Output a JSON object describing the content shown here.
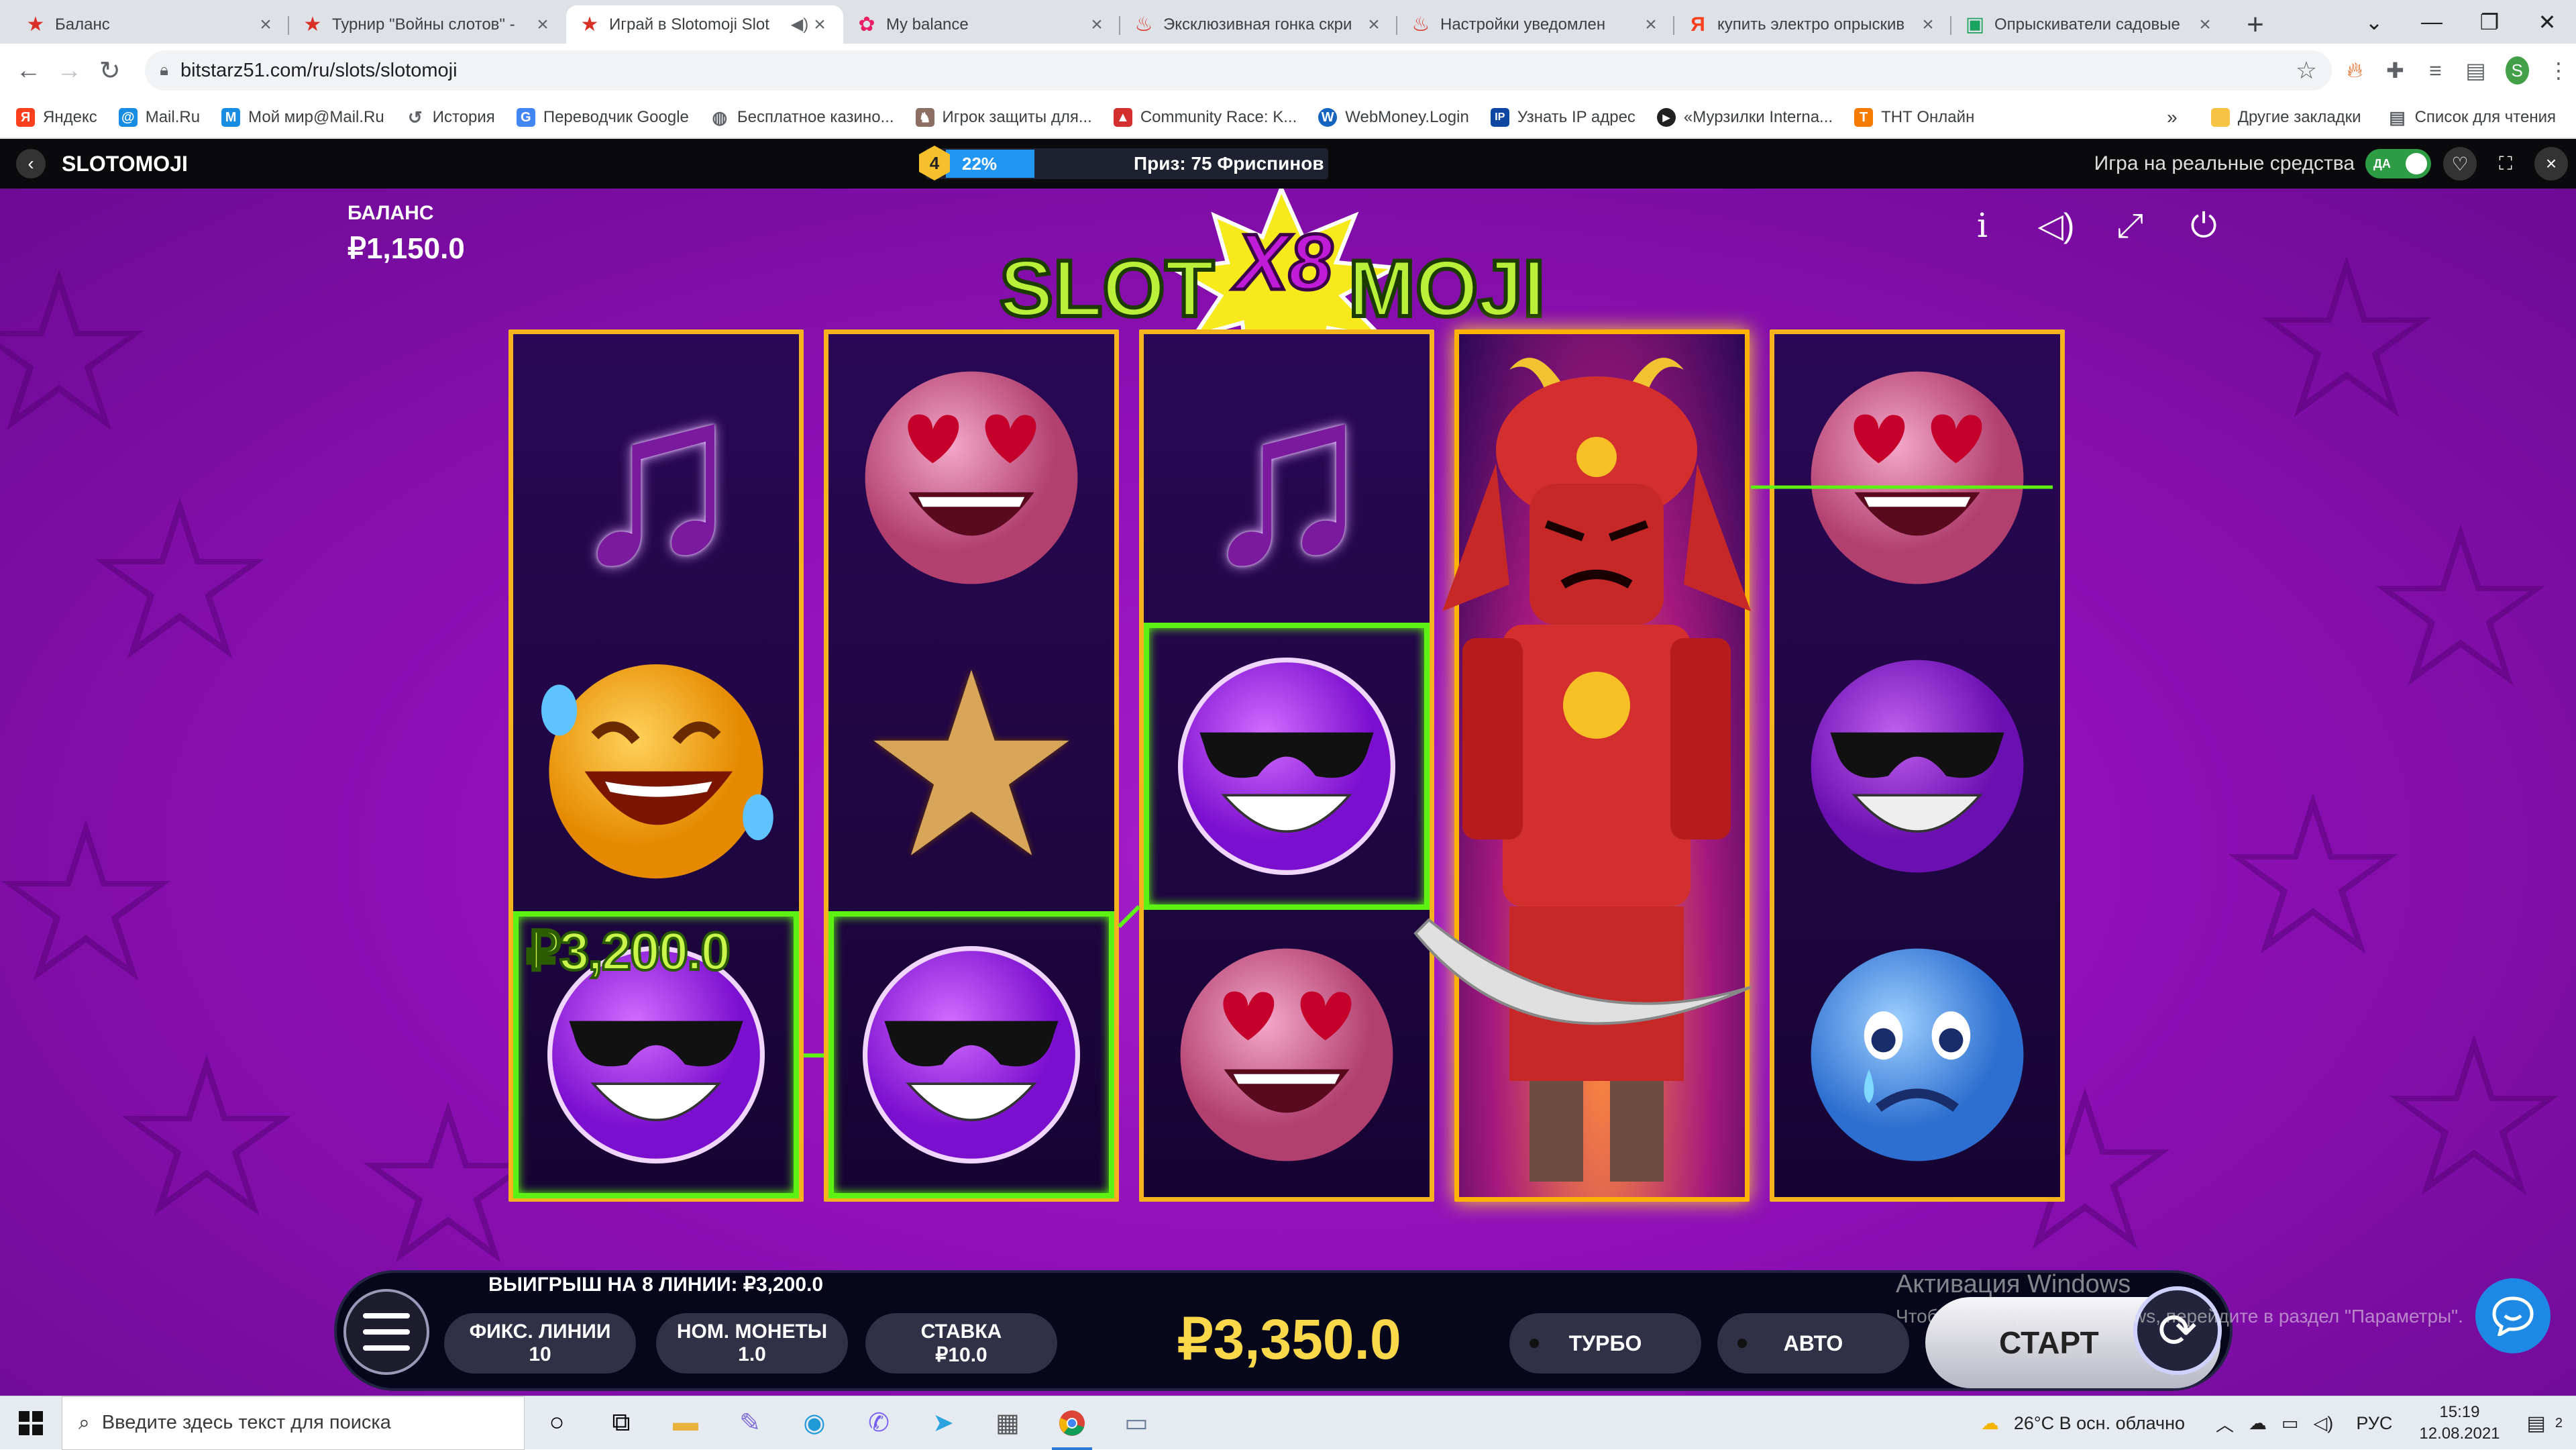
{
  "browser": {
    "tabs": [
      {
        "title": "Баланс",
        "icon": "star-icon",
        "color": "#d93025",
        "active": false
      },
      {
        "title": "Турнир \"Войны слотов\" -",
        "icon": "star-icon",
        "color": "#d93025",
        "active": false
      },
      {
        "title": "Играй в Slotomoji Slot",
        "icon": "star-icon",
        "color": "#d93025",
        "active": true
      },
      {
        "title": "My balance",
        "icon": "flower-icon",
        "color": "#e91e63",
        "active": false
      },
      {
        "title": "Эксклюзивная гонка скри",
        "icon": "gift-icon",
        "color": "#d93025",
        "active": false
      },
      {
        "title": "Настройки уведомлен",
        "icon": "gift-icon",
        "color": "#d93025",
        "active": false
      },
      {
        "title": "купить электро опрыскив",
        "icon": "yandex-icon",
        "color": "#fc3f1d",
        "active": false
      },
      {
        "title": "Опрыскиватели садовые",
        "icon": "page-icon",
        "color": "#1aa260",
        "active": false
      }
    ],
    "url": "bitstarz51.com/ru/slots/slotomoji",
    "profile_initial": "S",
    "bookmarks": [
      {
        "label": "Яндекс",
        "icon": "yandex-icon",
        "color": "#fc3f1d"
      },
      {
        "label": "Mail.Ru",
        "icon": "at-icon",
        "color": "#168de2"
      },
      {
        "label": "Мой мир@Mail.Ru",
        "icon": "world-icon",
        "color": "#168de2"
      },
      {
        "label": "История",
        "icon": "history-icon",
        "color": "#5f6368"
      },
      {
        "label": "Переводчик Google",
        "icon": "translate-icon",
        "color": "#4285f4"
      },
      {
        "label": "Бесплатное казино...",
        "icon": "globe-icon",
        "color": "#5f6368"
      },
      {
        "label": "Игрок защиты для...",
        "icon": "shield-icon",
        "color": "#8d6e63"
      },
      {
        "label": "Community Race: K...",
        "icon": "flame-icon",
        "color": "#d32f2f"
      },
      {
        "label": "WebMoney.Login",
        "icon": "wm-icon",
        "color": "#1565c0"
      },
      {
        "label": "Узнать IP адрес",
        "icon": "ip-icon",
        "color": "#0d47a1"
      },
      {
        "label": "«Мурзилки Interna...",
        "icon": "play-icon",
        "color": "#212121"
      },
      {
        "label": "ТНТ Онлайн",
        "icon": "tnt-icon",
        "color": "#f57c00"
      }
    ],
    "bookmarks_more": "»",
    "other_bookmarks": "Другие закладки",
    "reading_list": "Список для чтения"
  },
  "game_header": {
    "title": "SLOTOMOJI",
    "level": "4",
    "progress_pct": "22%",
    "progress_value": 0.22,
    "prize": "Приз: 75 Фриспинов",
    "real_money_label": "Игра на реальные средства",
    "toggle_label": "ДА"
  },
  "game": {
    "balance_label": "БАЛАНС",
    "balance_value": "₽1,150.0",
    "logo_text_left": "SLOT",
    "logo_multiplier": "X8",
    "logo_text_right": "MOJI",
    "win_amount_label": "₽3,200.0",
    "win_lines_text": "ВЫИГРЫШ НА 8 ЛИНИИ: ₽3,200.0",
    "reels": [
      [
        "music-note",
        "laughing-tears",
        "sunglasses"
      ],
      [
        "heart-eyes",
        "star",
        "sunglasses"
      ],
      [
        "music-note",
        "sunglasses",
        "heart-eyes"
      ],
      [
        "samurai-wild",
        "samurai-wild",
        "samurai-wild"
      ],
      [
        "heart-eyes",
        "sunglasses",
        "crying"
      ]
    ],
    "winning_cells": [
      "0-2",
      "1-2",
      "2-1"
    ],
    "controls": {
      "lines_label": "ФИКС. ЛИНИИ",
      "lines_value": "10",
      "coin_label": "НОМ. МОНЕТЫ",
      "coin_value": "1.0",
      "bet_label": "СТАВКА",
      "bet_value": "₽10.0",
      "total_balance": "₽3,350.0",
      "turbo_label": "ТУРБО",
      "auto_label": "АВТО",
      "start_label": "СТАРТ"
    }
  },
  "windows_activation": {
    "title": "Активация Windows",
    "subtitle": "Чтобы активировать Windows, перейдите в раздел \"Параметры\"."
  },
  "taskbar": {
    "search_placeholder": "Введите здесь текст для поиска",
    "weather": "26°C  В осн. облачно",
    "language": "РУС",
    "time": "15:19",
    "date": "12.08.2021",
    "notification_count": "2"
  }
}
